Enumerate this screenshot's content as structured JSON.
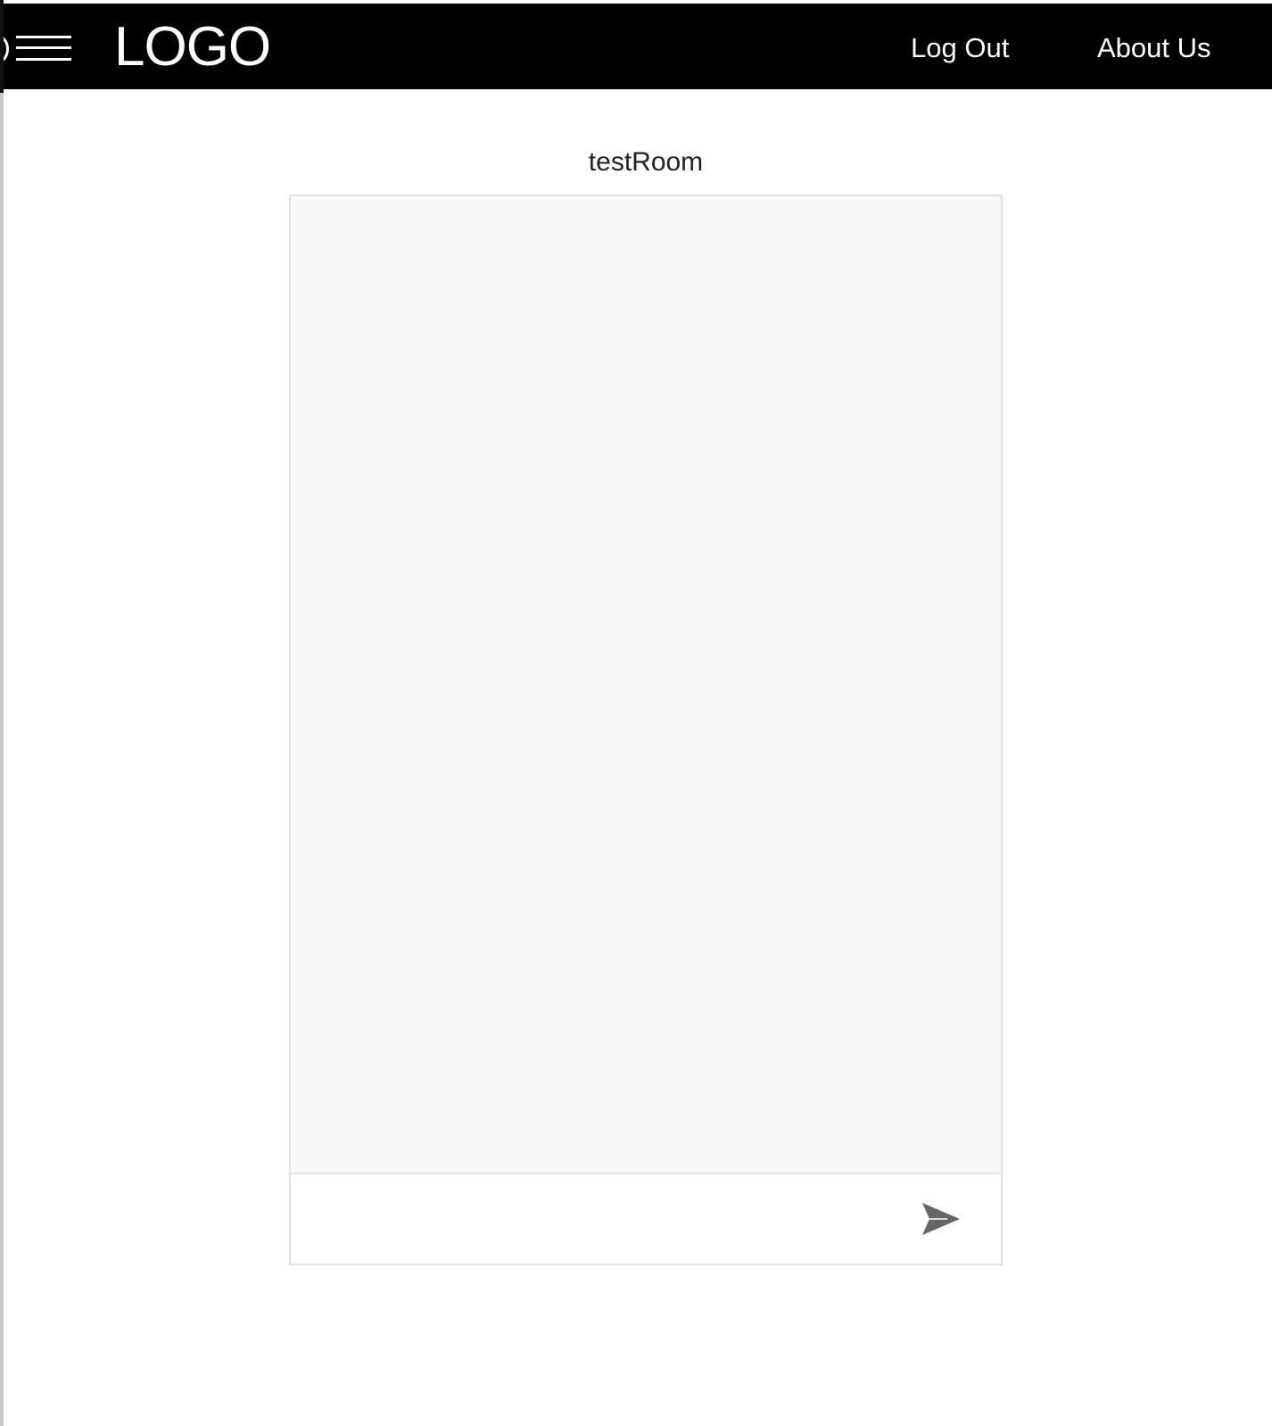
{
  "navbar": {
    "logo": "LOGO",
    "menu_icon": "hamburger-menu-icon",
    "links": [
      {
        "label": "Log Out"
      },
      {
        "label": "About Us"
      }
    ],
    "background": "#000000",
    "text_color": "#ffffff"
  },
  "chat": {
    "room_name": "testRoom",
    "message_input": {
      "value": "",
      "placeholder": ""
    },
    "send_icon": "send-paper-plane-icon",
    "message_area_color": "#f8f8f8",
    "border_color": "#e2e2e2",
    "icon_color": "#666666"
  }
}
